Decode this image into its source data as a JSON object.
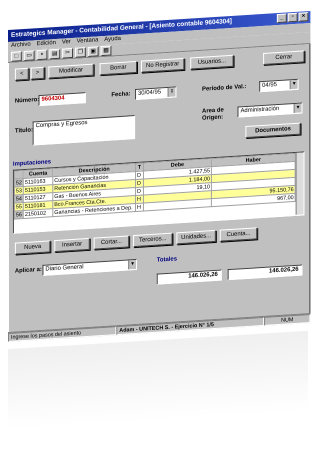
{
  "window": {
    "title": "Estrategics Manager - Contabilidad General - [Asiento contable 9604304]",
    "buttons": [
      "_",
      "▫",
      "×"
    ]
  },
  "menu": [
    "Archivo",
    "Edición",
    "Ver",
    "Ventana",
    "Ayuda"
  ],
  "toolbar_icons": [
    "new-icon",
    "open-icon",
    "save-icon",
    "print-icon",
    "cut-icon",
    "copy-icon",
    "paste-icon",
    "calc-icon"
  ],
  "nav": {
    "prev": "<",
    "next": ">",
    "modify": "Modificar",
    "delete": "Borrar",
    "undo": "No Registrar",
    "users": "Usuarios...",
    "close": "Cerrar"
  },
  "form": {
    "number_label": "Número:",
    "number_value": "9604304",
    "date_label": "Fecha:",
    "date_value": "30/04/95",
    "period_label": "Período de Val.:",
    "period_value": "04/95",
    "origin_label": "Area de Origen:",
    "origin_value": "Administración",
    "title_label": "Título:",
    "title_value": "Compras y Egresos",
    "documents": "Documentos"
  },
  "imputations": {
    "section_label": "Imputaciones",
    "columns": [
      "",
      "Cuenta",
      "Descripción",
      "T",
      "Debe",
      "Haber"
    ],
    "rows": [
      {
        "n": "52",
        "cuenta": "5110163",
        "desc": "Cursos y Capacitación",
        "t": "D",
        "debe": "1.427,55",
        "haber": "",
        "hl": false
      },
      {
        "n": "53",
        "cuenta": "5110153",
        "desc": "Retención Ganancias",
        "t": "D",
        "debe": "1.184,00",
        "haber": "",
        "hl": true
      },
      {
        "n": "54",
        "cuenta": "5110127",
        "desc": "Gas - Buenos Aires",
        "t": "D",
        "debe": "19,10",
        "haber": "",
        "hl": false
      },
      {
        "n": "55",
        "cuenta": "5110181",
        "desc": "Bco.Frances Cta.Cte.",
        "t": "H",
        "debe": "",
        "haber": "95.150,76",
        "hl": true
      },
      {
        "n": "56",
        "cuenta": "2150102",
        "desc": "Ganancias - Retenciones a Dep.",
        "t": "H",
        "debe": "",
        "haber": "967,00",
        "hl": false
      }
    ]
  },
  "actions": [
    "Nueva",
    "Insertar",
    "Cortar...",
    "Terceros...",
    "Unidades...",
    "Cuenta..."
  ],
  "apply": {
    "label": "Aplicar a:",
    "value": "Diario General"
  },
  "totals": {
    "label": "Totales",
    "debe": "146.026,26",
    "haber": "146.026,26"
  },
  "status": {
    "hint": "Ingrese los pasos del asiento",
    "company": "Adam - UNITECH S. - Ejercicio N° 1/5",
    "num": "NUM"
  }
}
